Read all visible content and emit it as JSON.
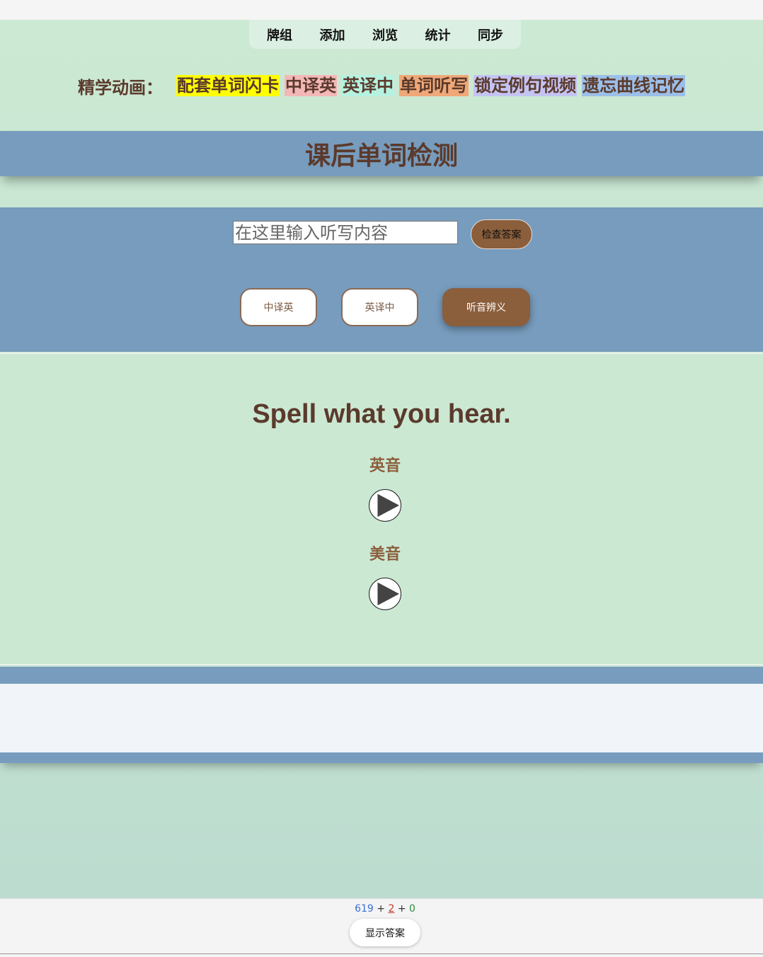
{
  "nav": {
    "items": [
      "牌组",
      "添加",
      "浏览",
      "统计",
      "同步"
    ]
  },
  "jingxue": {
    "label": "精学动画：",
    "links": [
      {
        "text": "配套单词闪卡",
        "bg": "#ffff00"
      },
      {
        "text": "中译英",
        "bg": "#f4b7b7"
      },
      {
        "text": "英译中",
        "bg": "#b6f2e0"
      },
      {
        "text": "单词听写",
        "bg": "#f0a878"
      },
      {
        "text": "锁定例句视频",
        "bg": "#c4c4f4"
      },
      {
        "text": "遗忘曲线记忆",
        "bg": "#9cbfe8"
      }
    ]
  },
  "title": "课后单词检测",
  "input": {
    "placeholder": "在这里输入听写内容",
    "check_label": "检查答案"
  },
  "modes": {
    "zh_en": "中译英",
    "en_zh": "英译中",
    "listen": "听音辨义",
    "active": "听音辨义"
  },
  "quiz": {
    "prompt": "Spell what you hear.",
    "uk_label": "英音",
    "us_label": "美音"
  },
  "footer": {
    "new_count": "619",
    "learn_count": "2",
    "review_count": "0",
    "plus": "+",
    "show_answer": "显示答案"
  }
}
